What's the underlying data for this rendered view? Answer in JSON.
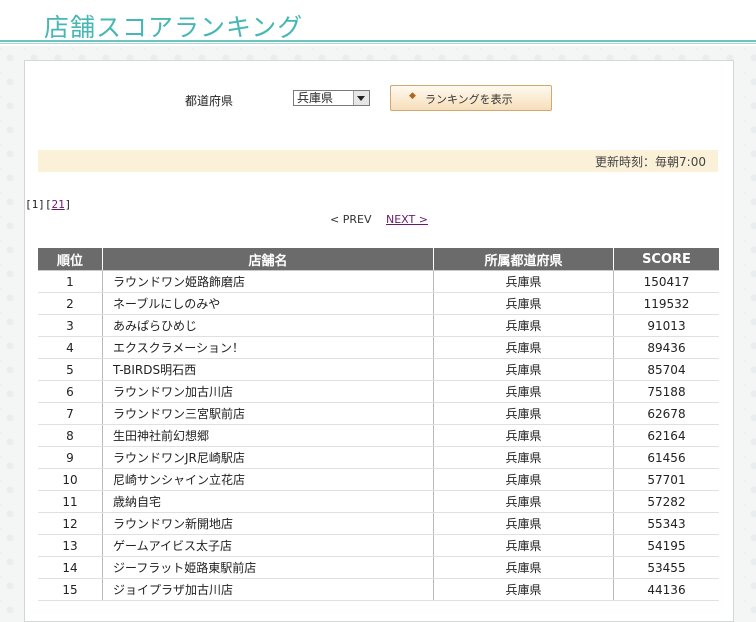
{
  "header": {
    "title": "店舗スコアランキング"
  },
  "filter": {
    "prefecture_label": "都道府県",
    "prefecture_selected": "兵庫県",
    "show_button_icon": "◆",
    "show_button_label": "ランキングを表示"
  },
  "update_text": "更新時刻：毎朝7:00",
  "pager": {
    "current": "1",
    "other": "21"
  },
  "nav": {
    "prev": "< PREV",
    "next": "NEXT >"
  },
  "table": {
    "headers": [
      "順位",
      "店舗名",
      "所属都道府県",
      "SCORE"
    ],
    "rows": [
      {
        "rank": "1",
        "name": "ラウンドワン姫路飾磨店",
        "pref": "兵庫県",
        "score": "150417"
      },
      {
        "rank": "2",
        "name": "ネーブルにしのみや",
        "pref": "兵庫県",
        "score": "119532"
      },
      {
        "rank": "3",
        "name": "あみぱらひめじ",
        "pref": "兵庫県",
        "score": "91013"
      },
      {
        "rank": "4",
        "name": "エクスクラメーション！",
        "pref": "兵庫県",
        "score": "89436"
      },
      {
        "rank": "5",
        "name": "T-BIRDS明石西",
        "pref": "兵庫県",
        "score": "85704"
      },
      {
        "rank": "6",
        "name": "ラウンドワン加古川店",
        "pref": "兵庫県",
        "score": "75188"
      },
      {
        "rank": "7",
        "name": "ラウンドワン三宮駅前店",
        "pref": "兵庫県",
        "score": "62678"
      },
      {
        "rank": "8",
        "name": "生田神社前幻想郷",
        "pref": "兵庫県",
        "score": "62164"
      },
      {
        "rank": "9",
        "name": "ラウンドワンJR尼崎駅店",
        "pref": "兵庫県",
        "score": "61456"
      },
      {
        "rank": "10",
        "name": "尼崎サンシャイン立花店",
        "pref": "兵庫県",
        "score": "57701"
      },
      {
        "rank": "11",
        "name": "歳納自宅",
        "pref": "兵庫県",
        "score": "57282"
      },
      {
        "rank": "12",
        "name": "ラウンドワン新開地店",
        "pref": "兵庫県",
        "score": "55343"
      },
      {
        "rank": "13",
        "name": "ゲームアイビス太子店",
        "pref": "兵庫県",
        "score": "54195"
      },
      {
        "rank": "14",
        "name": "ジーフラット姫路東駅前店",
        "pref": "兵庫県",
        "score": "53455"
      },
      {
        "rank": "15",
        "name": "ジョイプラザ加古川店",
        "pref": "兵庫県",
        "score": "44136"
      }
    ]
  }
}
